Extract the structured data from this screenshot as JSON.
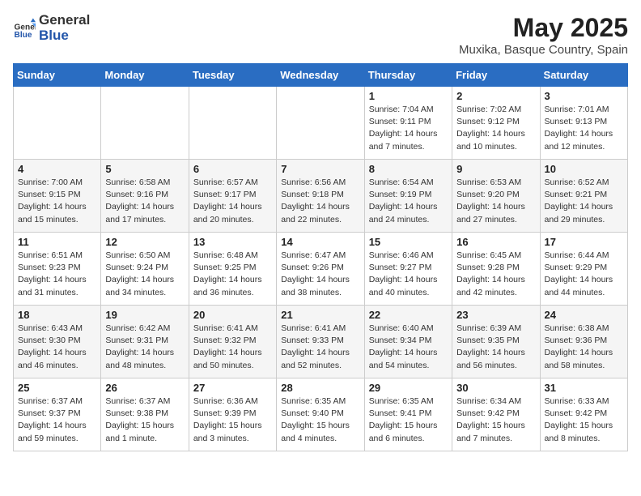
{
  "logo": {
    "general": "General",
    "blue": "Blue"
  },
  "title": {
    "month": "May 2025",
    "location": "Muxika, Basque Country, Spain"
  },
  "weekdays": [
    "Sunday",
    "Monday",
    "Tuesday",
    "Wednesday",
    "Thursday",
    "Friday",
    "Saturday"
  ],
  "weeks": [
    [
      {
        "day": "",
        "info": ""
      },
      {
        "day": "",
        "info": ""
      },
      {
        "day": "",
        "info": ""
      },
      {
        "day": "",
        "info": ""
      },
      {
        "day": "1",
        "info": "Sunrise: 7:04 AM\nSunset: 9:11 PM\nDaylight: 14 hours\nand 7 minutes."
      },
      {
        "day": "2",
        "info": "Sunrise: 7:02 AM\nSunset: 9:12 PM\nDaylight: 14 hours\nand 10 minutes."
      },
      {
        "day": "3",
        "info": "Sunrise: 7:01 AM\nSunset: 9:13 PM\nDaylight: 14 hours\nand 12 minutes."
      }
    ],
    [
      {
        "day": "4",
        "info": "Sunrise: 7:00 AM\nSunset: 9:15 PM\nDaylight: 14 hours\nand 15 minutes."
      },
      {
        "day": "5",
        "info": "Sunrise: 6:58 AM\nSunset: 9:16 PM\nDaylight: 14 hours\nand 17 minutes."
      },
      {
        "day": "6",
        "info": "Sunrise: 6:57 AM\nSunset: 9:17 PM\nDaylight: 14 hours\nand 20 minutes."
      },
      {
        "day": "7",
        "info": "Sunrise: 6:56 AM\nSunset: 9:18 PM\nDaylight: 14 hours\nand 22 minutes."
      },
      {
        "day": "8",
        "info": "Sunrise: 6:54 AM\nSunset: 9:19 PM\nDaylight: 14 hours\nand 24 minutes."
      },
      {
        "day": "9",
        "info": "Sunrise: 6:53 AM\nSunset: 9:20 PM\nDaylight: 14 hours\nand 27 minutes."
      },
      {
        "day": "10",
        "info": "Sunrise: 6:52 AM\nSunset: 9:21 PM\nDaylight: 14 hours\nand 29 minutes."
      }
    ],
    [
      {
        "day": "11",
        "info": "Sunrise: 6:51 AM\nSunset: 9:23 PM\nDaylight: 14 hours\nand 31 minutes."
      },
      {
        "day": "12",
        "info": "Sunrise: 6:50 AM\nSunset: 9:24 PM\nDaylight: 14 hours\nand 34 minutes."
      },
      {
        "day": "13",
        "info": "Sunrise: 6:48 AM\nSunset: 9:25 PM\nDaylight: 14 hours\nand 36 minutes."
      },
      {
        "day": "14",
        "info": "Sunrise: 6:47 AM\nSunset: 9:26 PM\nDaylight: 14 hours\nand 38 minutes."
      },
      {
        "day": "15",
        "info": "Sunrise: 6:46 AM\nSunset: 9:27 PM\nDaylight: 14 hours\nand 40 minutes."
      },
      {
        "day": "16",
        "info": "Sunrise: 6:45 AM\nSunset: 9:28 PM\nDaylight: 14 hours\nand 42 minutes."
      },
      {
        "day": "17",
        "info": "Sunrise: 6:44 AM\nSunset: 9:29 PM\nDaylight: 14 hours\nand 44 minutes."
      }
    ],
    [
      {
        "day": "18",
        "info": "Sunrise: 6:43 AM\nSunset: 9:30 PM\nDaylight: 14 hours\nand 46 minutes."
      },
      {
        "day": "19",
        "info": "Sunrise: 6:42 AM\nSunset: 9:31 PM\nDaylight: 14 hours\nand 48 minutes."
      },
      {
        "day": "20",
        "info": "Sunrise: 6:41 AM\nSunset: 9:32 PM\nDaylight: 14 hours\nand 50 minutes."
      },
      {
        "day": "21",
        "info": "Sunrise: 6:41 AM\nSunset: 9:33 PM\nDaylight: 14 hours\nand 52 minutes."
      },
      {
        "day": "22",
        "info": "Sunrise: 6:40 AM\nSunset: 9:34 PM\nDaylight: 14 hours\nand 54 minutes."
      },
      {
        "day": "23",
        "info": "Sunrise: 6:39 AM\nSunset: 9:35 PM\nDaylight: 14 hours\nand 56 minutes."
      },
      {
        "day": "24",
        "info": "Sunrise: 6:38 AM\nSunset: 9:36 PM\nDaylight: 14 hours\nand 58 minutes."
      }
    ],
    [
      {
        "day": "25",
        "info": "Sunrise: 6:37 AM\nSunset: 9:37 PM\nDaylight: 14 hours\nand 59 minutes."
      },
      {
        "day": "26",
        "info": "Sunrise: 6:37 AM\nSunset: 9:38 PM\nDaylight: 15 hours\nand 1 minute."
      },
      {
        "day": "27",
        "info": "Sunrise: 6:36 AM\nSunset: 9:39 PM\nDaylight: 15 hours\nand 3 minutes."
      },
      {
        "day": "28",
        "info": "Sunrise: 6:35 AM\nSunset: 9:40 PM\nDaylight: 15 hours\nand 4 minutes."
      },
      {
        "day": "29",
        "info": "Sunrise: 6:35 AM\nSunset: 9:41 PM\nDaylight: 15 hours\nand 6 minutes."
      },
      {
        "day": "30",
        "info": "Sunrise: 6:34 AM\nSunset: 9:42 PM\nDaylight: 15 hours\nand 7 minutes."
      },
      {
        "day": "31",
        "info": "Sunrise: 6:33 AM\nSunset: 9:42 PM\nDaylight: 15 hours\nand 8 minutes."
      }
    ]
  ]
}
